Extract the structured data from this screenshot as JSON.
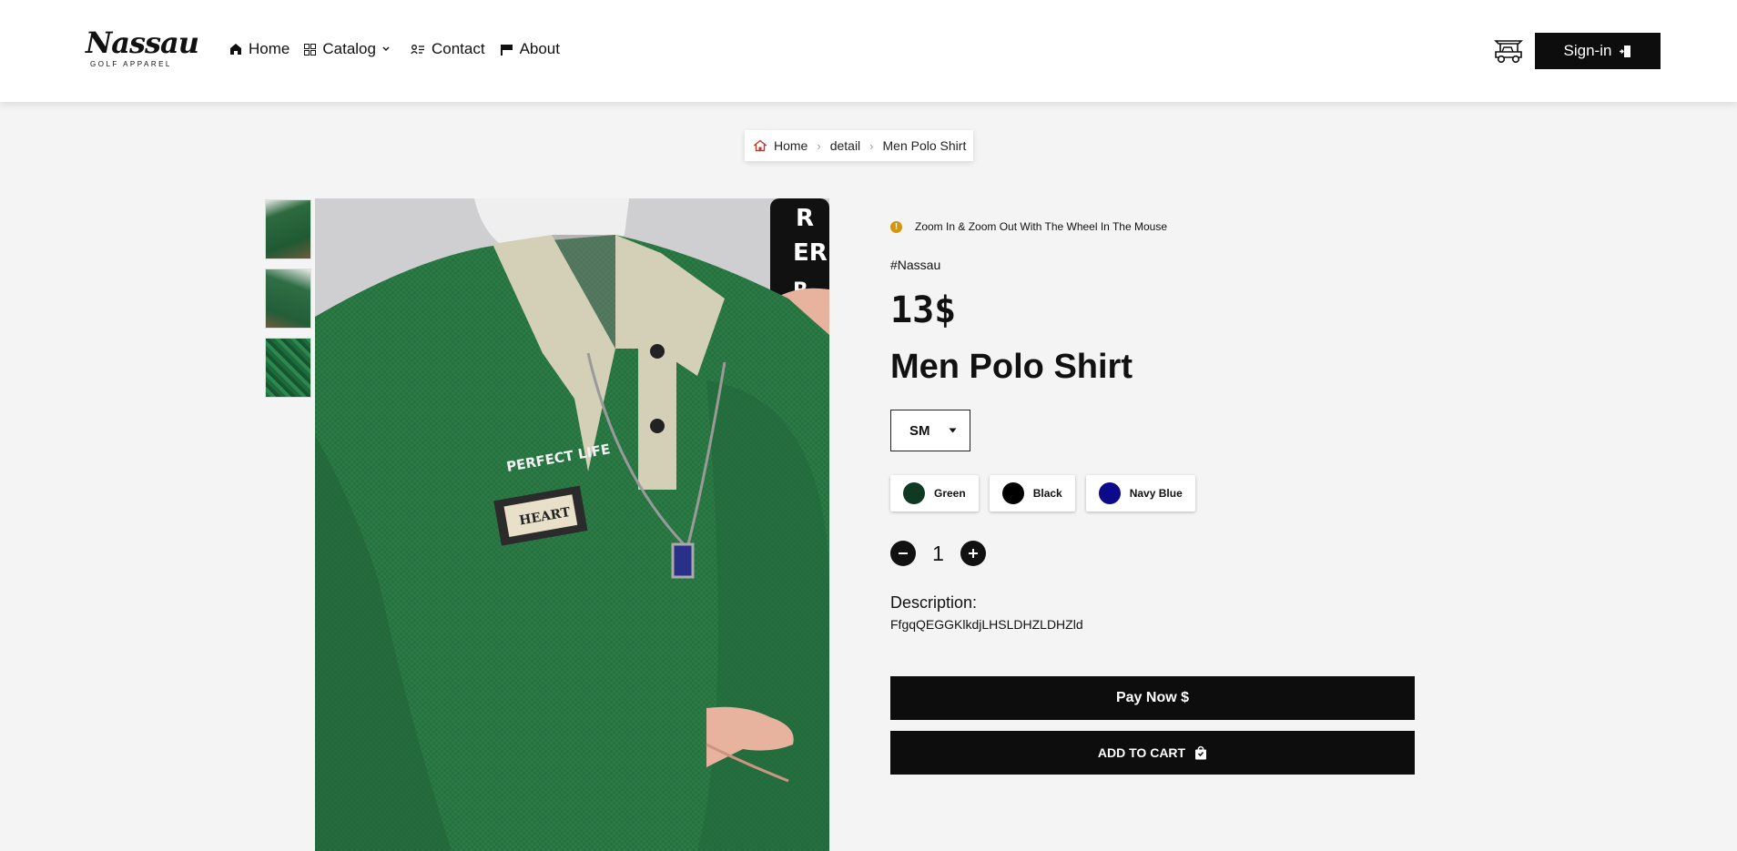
{
  "brand": {
    "logo_script": "Nassau",
    "logo_sub": "GOLF APPAREL"
  },
  "nav": {
    "items": [
      {
        "label": "Home",
        "icon": "home-icon"
      },
      {
        "label": "Catalog",
        "icon": "grid-icon"
      },
      {
        "label": "Contact",
        "icon": "contact-card-icon"
      },
      {
        "label": "About",
        "icon": "flag-icon"
      }
    ]
  },
  "header": {
    "signin_label": "Sign-in",
    "cart_icon": "golf-cart-icon"
  },
  "breadcrumb": {
    "items": [
      "Home",
      "detail",
      "Men Polo Shirt"
    ]
  },
  "product": {
    "zoom_tip": "Zoom In & Zoom Out With The Wheel In The Mouse",
    "tag": "#Nassau",
    "price": "13$",
    "name": "Men Polo Shirt",
    "size_selected": "SM",
    "colors": [
      {
        "label": "Green",
        "hex": "#0e3a24"
      },
      {
        "label": "Black",
        "hex": "#000000"
      },
      {
        "label": "Navy Blue",
        "hex": "#0a0a8a"
      }
    ],
    "quantity": "1",
    "description_label": "Description:",
    "description_text": "FfgqQEGGKlkdjLHSLDHZLDHZld",
    "image_texts": {
      "patch_top": "PERFECT LIFE",
      "patch_label": "HEART"
    }
  },
  "actions": {
    "pay_label": "Pay Now $",
    "add_to_cart_label": "ADD TO CART"
  },
  "colors": {
    "accent_dark": "#0d0d0d",
    "tip_dot": "#d4950a"
  }
}
